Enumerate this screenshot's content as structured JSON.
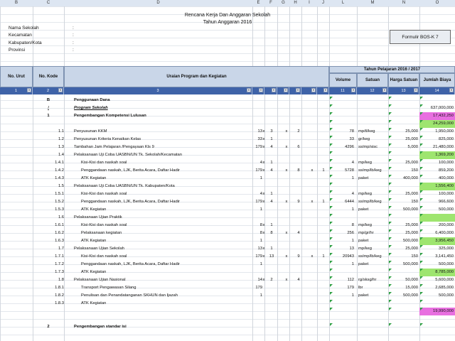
{
  "columns": [
    "B",
    "C",
    "D",
    "E",
    "F",
    "G",
    "H",
    "I",
    "J",
    "K",
    "L",
    "M",
    "N",
    "O"
  ],
  "title": "Rencana Kerja Dan Anggaran Sekolah",
  "subtitle": "Tahun Anggaran 2016",
  "info_labels": [
    "Nama Sekolah",
    "Kecamatan",
    "Kabupaten/Kota",
    "Provinsi"
  ],
  "colon": ":",
  "formulir": "Formulir BOS-K 7",
  "headers": {
    "no_urut": "No. Urut",
    "no_kode": "No. Kode",
    "uraian": "Uraian Program dan Kegiatan",
    "tahun": "Tahun Pelajaran 2016 / 2017",
    "volume": "Volume",
    "satuan": "Satuan",
    "harga": "Harga Satuan",
    "jumlah": "Jumlah Biaya"
  },
  "index": [
    "1",
    "2",
    "3",
    "",
    "",
    "",
    "",
    "",
    "",
    "",
    "11",
    "12",
    "13",
    "14"
  ],
  "rows": [
    {
      "code": "B",
      "desc": "Penggunaan Dana",
      "style": "bold"
    },
    {
      "code": "I",
      "desc": "Program Sekolah",
      "style": "ital",
      "jumlah": "637,000,000"
    },
    {
      "code": "1",
      "desc": "Pengembangan Kompetensi Lulusan",
      "style": "bold",
      "jumlah": "17,432,250",
      "hl": "pink"
    },
    {
      "desc": "",
      "jumlah": "24,259,000",
      "hl": "green"
    },
    {
      "num": "1.1",
      "desc": "Penyusunan KKM",
      "q1": "13",
      "x1": "x",
      "q2": "3",
      "x2": "x",
      "q3": "2",
      "vol": "78",
      "sat": "mp/tl/keg",
      "harga": "25,000",
      "jumlah": "1,950,000"
    },
    {
      "num": "1.2",
      "desc": "Penyusunan Kriteria Kenaikan Kelas",
      "q1": "33",
      "x1": "x",
      "q2": "1",
      "vol": "33",
      "sat": "gr/keg",
      "harga": "25,000",
      "jumlah": "825,000"
    },
    {
      "num": "1.3",
      "desc": "Tambahan Jam Pelajaran /Pengayaan Kls 9",
      "q1": "179",
      "x1": "x",
      "q2": "4",
      "x2": "x",
      "q3": "6",
      "vol": "4296",
      "sat": "ss/mp/sisc",
      "harga": "5,000",
      "jumlah": "21,480,000"
    },
    {
      "num": "1.4",
      "desc": "Pelaksanaan Uji Coba UASBN/UN Tk. Sekolah/Kecamatan",
      "jumlah": "1,369,200",
      "hl": "green"
    },
    {
      "num": "1.4.1",
      "desc": "Kisi-Kisi dan naskah soal",
      "q1": "4",
      "x1": "x",
      "q2": "1",
      "vol": "4",
      "sat": "mp/keg",
      "harga": "25,000",
      "jumlah": "100,000"
    },
    {
      "num": "1.4.2",
      "desc": "Penggandaan naskah, LJK, Berita Acara, Daftar Hadir",
      "q1": "179",
      "x1": "x",
      "q2": "4",
      "x2": "x",
      "q3": "8",
      "x3": "x",
      "q4": "1",
      "vol": "5728",
      "sat": "ss/mp/lb/keg",
      "harga": "150",
      "jumlah": "859,200"
    },
    {
      "num": "1.4.3",
      "desc": "ATK Kegiatan",
      "q1": "1",
      "vol": "1",
      "sat": "paket",
      "harga": "400,000",
      "jumlah": "400,000"
    },
    {
      "num": "1.5",
      "desc": "Pelaksanaan Uji Coba UASBN/UN Tk. Kabupaten/Kota",
      "jumlah": "1,556,400",
      "hl": "green"
    },
    {
      "num": "1.5.1",
      "desc": "Kisi-Kisi dan naskah soal",
      "q1": "4",
      "x1": "x",
      "q2": "1",
      "vol": "4",
      "sat": "mp/keg",
      "harga": "25,000",
      "jumlah": "100,000"
    },
    {
      "num": "1.5.2",
      "desc": "Penggandaan naskah, LJK, Berita Acara, Daftar Hadir",
      "q1": "179",
      "x1": "x",
      "q2": "4",
      "x2": "x",
      "q3": "9",
      "x3": "x",
      "q4": "1",
      "vol": "6444",
      "sat": "ss/mp/lb/keg",
      "harga": "150",
      "jumlah": "966,600"
    },
    {
      "num": "1.5.3",
      "desc": "ATK Kegiatan",
      "q1": "1",
      "vol": "1",
      "sat": "paket",
      "harga": "500,000",
      "jumlah": "500,000"
    },
    {
      "num": "1.6",
      "desc": "Pelaksanaan Ujian Praktik",
      "jumlah": "",
      "hl": "green"
    },
    {
      "num": "1.6.1",
      "desc": "Kisi-Kisi dan naskah soal",
      "q1": "8",
      "x1": "x",
      "q2": "1",
      "vol": "8",
      "sat": "mp/keg",
      "harga": "25,000",
      "jumlah": "200,000"
    },
    {
      "num": "1.6.2",
      "desc": "Pelaksanaan kegiatan",
      "q1": "8",
      "x1": "x",
      "q2": "8",
      "x2": "x",
      "q3": "4",
      "vol": "256",
      "sat": "mp/gr/hr",
      "harga": "25,000",
      "jumlah": "6,400,000"
    },
    {
      "num": "1.6.3",
      "desc": "ATK Kegiatan",
      "q1": "1",
      "vol": "1",
      "sat": "paket",
      "harga": "500,000",
      "jumlah": "3,956,450",
      "hl": "green"
    },
    {
      "num": "1.7",
      "desc": "Pelaksanaan Ujian Sekolah",
      "q1": "13",
      "x1": "x",
      "q2": "1",
      "vol": "13",
      "sat": "mp/keg",
      "harga": "25,000",
      "jumlah": "325,000"
    },
    {
      "num": "1.7.1",
      "desc": "Kisi-Kisi dan naskah soal",
      "q1": "179",
      "x1": "x",
      "q2": "13",
      "x2": "x",
      "q3": "9",
      "x3": "x",
      "q4": "1",
      "vol": "20943",
      "sat": "ss/mp/lb/keg",
      "harga": "150",
      "jumlah": "3,141,450"
    },
    {
      "num": "1.7.2",
      "desc": "Penggandaan naskah, LJK, Berita Acara, Daftar Hadir",
      "q1": "1",
      "vol": "1",
      "sat": "paket",
      "harga": "500,000",
      "jumlah": "500,000"
    },
    {
      "num": "1.7.3",
      "desc": "ATK Kegiatan",
      "jumlah": "8,785,000",
      "hl": "green"
    },
    {
      "num": "1.8",
      "desc": "Pelaksanaan Ujian Nasional",
      "q1": "14",
      "x1": "x",
      "q2": "2",
      "x2": "x",
      "q3": "4",
      "vol": "112",
      "sat": "rg/sksg/hr",
      "harga": "50,000",
      "jumlah": "5,600,000"
    },
    {
      "num": "1.8.1",
      "desc": "Transport Pengawasan Silang",
      "q1": "179",
      "vol": "179",
      "sat": "lbr",
      "harga": "15,000",
      "jumlah": "2,685,000"
    },
    {
      "num": "1.8.2",
      "desc": "Penulisan dan Penandatanganan SKHUN dan Ijazah",
      "q1": "1",
      "vol": "1",
      "sat": "paket",
      "harga": "500,000",
      "jumlah": "500,000"
    },
    {
      "num": "1.8.3",
      "desc": "ATK Kegiatan",
      "jumlah": ""
    },
    {
      "desc": "",
      "jumlah": "19,990,000",
      "hl": "pink"
    },
    {
      "desc": ""
    },
    {
      "code": "2",
      "desc": "Pengembangan standar isi",
      "style": "bold"
    }
  ]
}
